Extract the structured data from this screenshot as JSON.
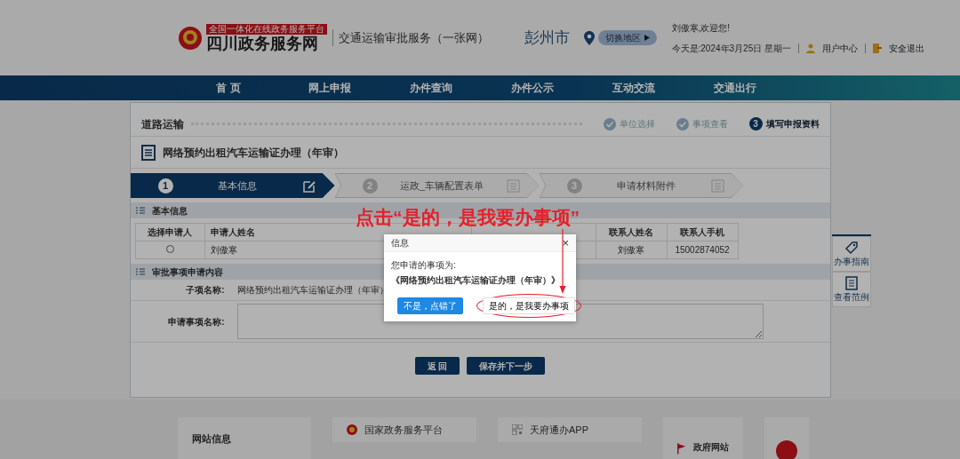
{
  "header": {
    "logo_tag": "全国一体化在线政务服务平台",
    "logo_name": "四川政务服务网",
    "subtitle": "交通运输审批服务（一张网）",
    "city": "彭州市",
    "switch_region": "切换地区",
    "greeting": "刘傲寒,欢迎您!",
    "date": "今天是:2024年3月25日 星期一",
    "links": [
      {
        "kind": "user",
        "label": "用户中心"
      },
      {
        "kind": "exit",
        "label": "安全退出"
      }
    ]
  },
  "nav": [
    "首 页",
    "网上申报",
    "办件查询",
    "办件公示",
    "互动交流",
    "交通出行"
  ],
  "breadcrumb": {
    "title": "道路运输",
    "steps": [
      {
        "label": "单位选择",
        "done": true
      },
      {
        "label": "事项查看",
        "done": true
      },
      {
        "label": "填写申报资料",
        "done": false,
        "number": "3"
      }
    ]
  },
  "form_title": "网络预约出租汽车运输证办理（年审）",
  "wizard": [
    {
      "number": "1",
      "label": "基本信息",
      "selected": true
    },
    {
      "number": "2",
      "label": "运政_车辆配置表单",
      "selected": false
    },
    {
      "number": "3",
      "label": "申请材料附件",
      "selected": false
    }
  ],
  "basic_section": {
    "title": "基本信息",
    "columns": [
      "选择申请人",
      "申请人姓名",
      "联系人姓名",
      "联系人手机"
    ],
    "rows": [
      {
        "checked": false,
        "applicant": "刘傲寒",
        "contact": "刘傲寒",
        "phone": "15002874052"
      }
    ]
  },
  "apply_section": {
    "title": "审批事项申请内容",
    "fields": [
      {
        "kind": "text",
        "label": "子项名称:",
        "value": "网络预约出租汽车运输证办理（年审）"
      },
      {
        "kind": "textarea",
        "label": "申请事项名称:"
      }
    ]
  },
  "actions": [
    "返 回",
    "保存并下一步"
  ],
  "side_tools": [
    {
      "kind": "tag",
      "label": "办事指南"
    },
    {
      "kind": "doc",
      "label": "查看范例"
    }
  ],
  "footer": {
    "info_title": "网站信息",
    "links": [
      {
        "kind": "emblem",
        "label": "国家政务服务平台"
      },
      {
        "kind": "qr",
        "label": "天府通办APP"
      }
    ],
    "gov_site": "政府网站"
  },
  "dialog": {
    "title": "信息",
    "close": "×",
    "message": "您申请的事项为:",
    "item": "《网络预约出租汽车运输证办理（年审）》",
    "buttons": [
      {
        "label": "不是，点错了",
        "primary": true,
        "highlighted": false
      },
      {
        "label": "是的，是我要办事项",
        "primary": false,
        "highlighted": true
      }
    ]
  },
  "annotation": "点击“是的，是我要办事项”"
}
